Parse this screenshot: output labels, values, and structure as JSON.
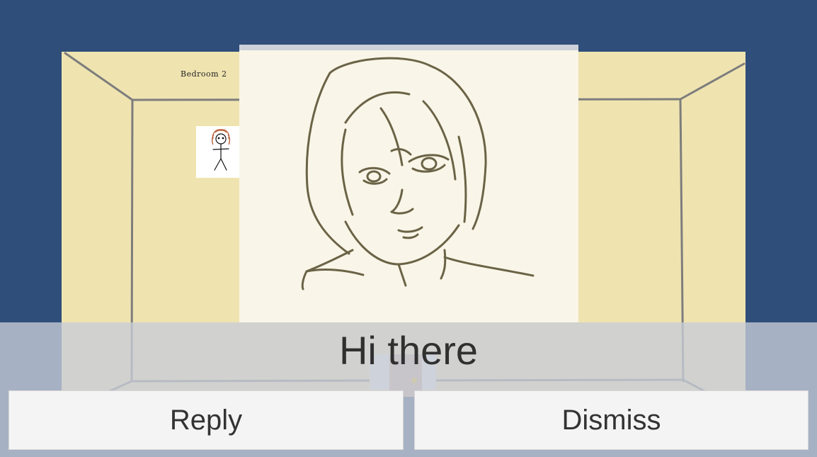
{
  "room": {
    "name": "Bedroom 2",
    "wall_color": "#efe4b0",
    "background_color": "#2f4e7a"
  },
  "dialog": {
    "message": "Hi there"
  },
  "buttons": {
    "reply_label": "Reply",
    "dismiss_label": "Dismiss"
  }
}
